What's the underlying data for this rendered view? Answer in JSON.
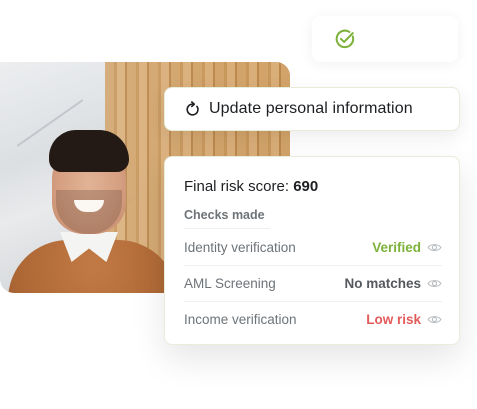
{
  "status_card": {
    "icon": "check-circle-icon",
    "icon_color": "#7db23a"
  },
  "update_card": {
    "icon": "refresh-icon",
    "label": "Update personal information"
  },
  "risk_card": {
    "title_prefix": "Final risk score: ",
    "score": "690",
    "checks_heading": "Checks made",
    "checks": [
      {
        "label": "Identity verification",
        "status": "Verified",
        "status_color": "#7db23a",
        "icon": "eye-icon"
      },
      {
        "label": "AML Screening",
        "status": "No matches",
        "status_color": "#55595e",
        "icon": "eye-icon"
      },
      {
        "label": "Income verification",
        "status": "Low risk",
        "status_color": "#e25b5b",
        "icon": "eye-icon"
      }
    ]
  },
  "photo": {
    "subject": "person-portrait"
  }
}
